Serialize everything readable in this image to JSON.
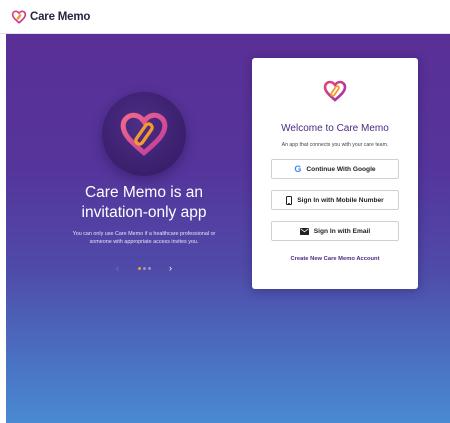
{
  "header": {
    "brand_name": "Care Memo",
    "logo_icon": "heart-clip-icon"
  },
  "hero": {
    "title_line1": "Care Memo is an",
    "title_line2": "invitation-only app",
    "subtitle_line1": "You can only use Care Memo if a healthcare professional or",
    "subtitle_line2": "someone with appropriate access invites you.",
    "carousel": {
      "slide_count": 3,
      "active_index": 0,
      "prev_icon": "chevron-left-icon",
      "next_icon": "chevron-right-icon"
    }
  },
  "login_card": {
    "title": "Welcome to Care Memo",
    "subtitle": "An app that connects you with your care team.",
    "google_button": "Continue With Google",
    "mobile_button": "Sign In with Mobile Number",
    "email_button": "Sign In with Email",
    "create_account_link": "Create New Care Memo Account"
  },
  "colors": {
    "brand_purple": "#4b2a86",
    "logo_pink": "#e8427a",
    "logo_orange": "#f59a2e",
    "carousel_active": "#f59a2e"
  }
}
